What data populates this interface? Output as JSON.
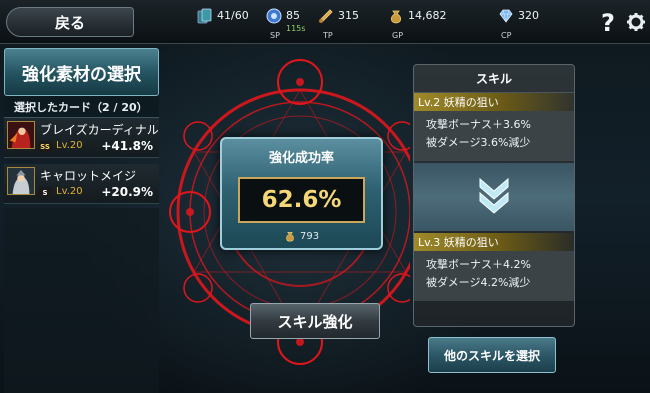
{
  "header": {
    "back_label": "戻る",
    "cards": {
      "icon": "cards-icon",
      "value": "41/60"
    },
    "sp": {
      "icon": "sp-orb-icon",
      "value": "85",
      "sub": "115s",
      "label": "SP"
    },
    "tp": {
      "icon": "scroll-icon",
      "value": "315",
      "label": "TP"
    },
    "gp": {
      "icon": "money-bag-icon",
      "value": "14,682",
      "label": "GP"
    },
    "cp": {
      "icon": "diamond-icon",
      "value": "320",
      "label": "CP"
    },
    "help_icon": "help-icon",
    "settings_icon": "gear-icon"
  },
  "left": {
    "title": "強化素材の選択",
    "selected_label": "選択したカード（2 / 20）",
    "cards": [
      {
        "name": "ブレイズカーディナル",
        "rank": "SS",
        "level": "Lv.20",
        "bonus": "+41.8%"
      },
      {
        "name": "キャロットメイジ",
        "rank": "S",
        "level": "Lv.20",
        "bonus": "+20.9%"
      }
    ]
  },
  "center": {
    "rate_title": "強化成功率",
    "rate_value": "62.6%",
    "cost": "793",
    "enhance_button": "スキル強化"
  },
  "skill": {
    "header": "スキル",
    "before": {
      "level_line": "Lv.2 妖精の狙い",
      "lines": [
        "攻撃ボーナス＋3.6%",
        "被ダメージ3.6%減少"
      ]
    },
    "after": {
      "level_line": "Lv.3 妖精の狙い",
      "lines": [
        "攻撃ボーナス＋4.2%",
        "被ダメージ4.2%減少"
      ]
    },
    "select_other_button": "他のスキルを選択"
  },
  "colors": {
    "accent_red": "#e0161c",
    "gold": "#f5d777",
    "teal": "#2f6272"
  }
}
